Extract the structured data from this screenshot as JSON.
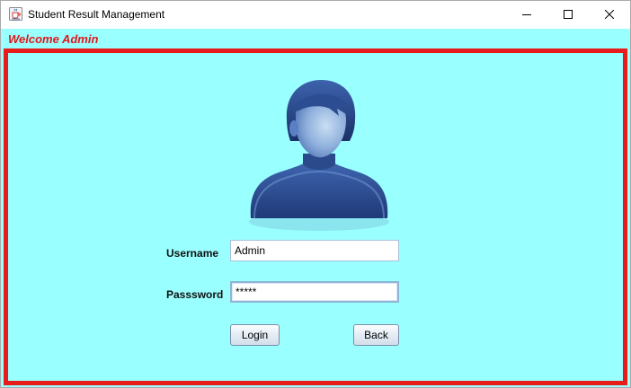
{
  "window": {
    "title": "Student Result Management",
    "icons": {
      "app": "java-cup-icon",
      "minimize": "minimize-icon",
      "maximize": "maximize-icon",
      "close": "close-icon"
    }
  },
  "header": {
    "welcome_text": "Welcome Admin",
    "welcome_color": "#e0181b"
  },
  "panel": {
    "border_color": "#e81b1b",
    "background_color": "#99ffff",
    "avatar_icon": "user-avatar-icon"
  },
  "form": {
    "username_label": "Username",
    "username_value": "Admin",
    "password_label": "Passsword",
    "password_value": "*****",
    "login_label": "Login",
    "back_label": "Back"
  }
}
